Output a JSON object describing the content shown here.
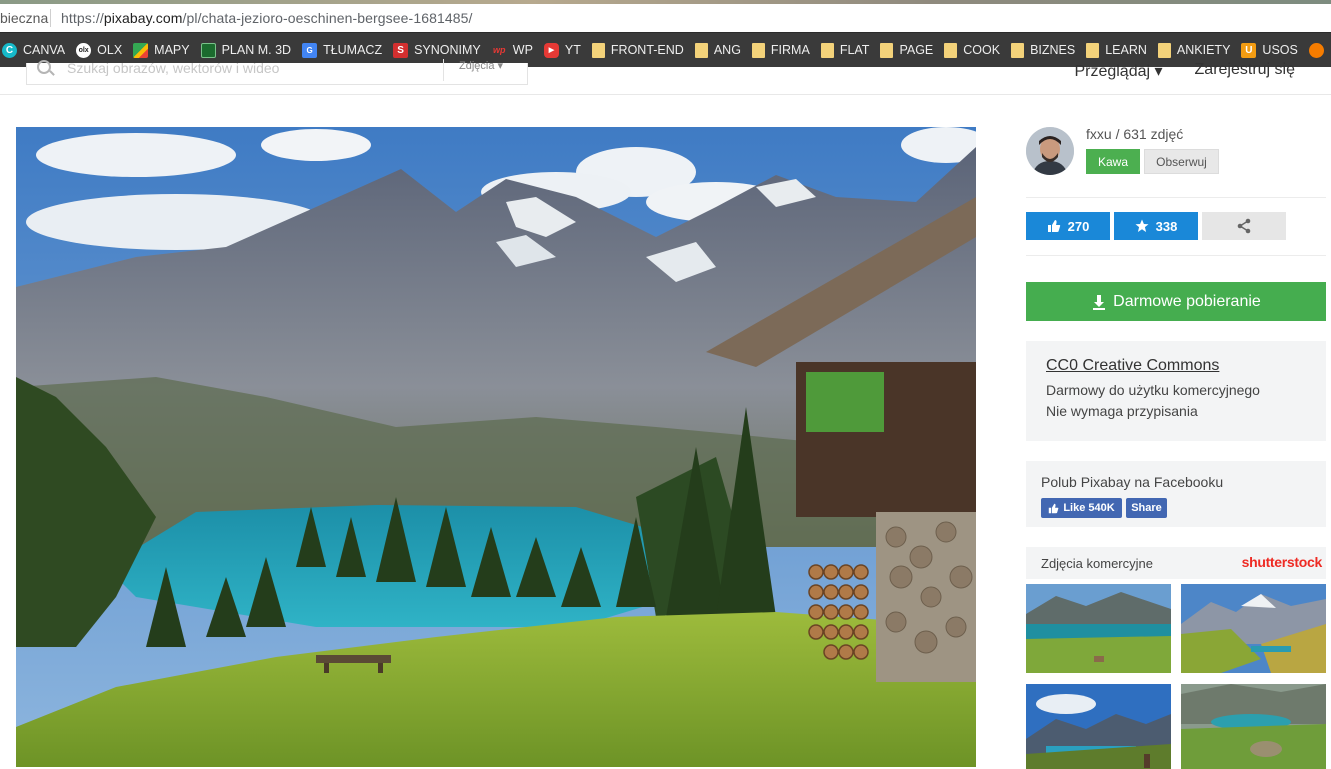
{
  "browser": {
    "security_label": "bieczna",
    "url_prefix": "https://",
    "url_host": "pixabay.com",
    "url_path": "/pl/chata-jezioro-oeschinen-bergsee-1681485/"
  },
  "bookmarks": [
    {
      "label": "CANVA",
      "icon": "canva-icon",
      "icon_text": "C"
    },
    {
      "label": "OLX",
      "icon": "olx-icon",
      "icon_text": "olx"
    },
    {
      "label": "MAPY",
      "icon": "maps-icon",
      "icon_text": ""
    },
    {
      "label": "PLAN M. 3D",
      "icon": "plan-icon",
      "icon_text": ""
    },
    {
      "label": "TŁUMACZ",
      "icon": "translate-icon",
      "icon_text": "G"
    },
    {
      "label": "SYNONIMY",
      "icon": "synonimy-icon",
      "icon_text": "S"
    },
    {
      "label": "WP",
      "icon": "wp-icon",
      "icon_text": "wp"
    },
    {
      "label": "YT",
      "icon": "youtube-icon",
      "icon_text": "▶"
    },
    {
      "label": "FRONT-END",
      "icon": "folder-icon",
      "icon_text": ""
    },
    {
      "label": "ANG",
      "icon": "folder-icon",
      "icon_text": ""
    },
    {
      "label": "FIRMA",
      "icon": "folder-icon",
      "icon_text": ""
    },
    {
      "label": "FLAT",
      "icon": "folder-icon",
      "icon_text": ""
    },
    {
      "label": "PAGE",
      "icon": "folder-icon",
      "icon_text": ""
    },
    {
      "label": "COOK",
      "icon": "folder-icon",
      "icon_text": ""
    },
    {
      "label": "BIZNES",
      "icon": "folder-icon",
      "icon_text": ""
    },
    {
      "label": "LEARN",
      "icon": "folder-icon",
      "icon_text": ""
    },
    {
      "label": "ANKIETY",
      "icon": "folder-icon",
      "icon_text": ""
    },
    {
      "label": "USOS",
      "icon": "usos-icon",
      "icon_text": "U"
    },
    {
      "label": "",
      "icon": "orange-icon",
      "icon_text": ""
    }
  ],
  "header": {
    "search_placeholder": "Szukaj obrazów, wektorów i wideo",
    "search_type": "Zdjęcia ▾",
    "nav_browse": "Przeglądaj ▾",
    "nav_register": "Zarejestruj się"
  },
  "author": {
    "name_line": "fxxu / 631 zdjęć",
    "coffee_label": "Kawa",
    "follow_label": "Obserwuj"
  },
  "stats": {
    "likes": "270",
    "favorites": "338"
  },
  "download": {
    "label": "Darmowe pobieranie"
  },
  "license": {
    "title": "CC0 Creative Commons",
    "line1": "Darmowy do użytku komercyjnego",
    "line2": "Nie wymaga przypisania"
  },
  "facebook": {
    "title": "Polub Pixabay na Facebooku",
    "like_label": "Like 540K",
    "share_label": "Share"
  },
  "commercial": {
    "title": "Zdjęcia komercyjne",
    "brand": "shutterstock"
  },
  "colors": {
    "bookmark_bar": "#3a3a3a",
    "like_blue": "#1a88d8",
    "download_green": "#45ad4f",
    "coffee_green": "#4caf50",
    "facebook_blue": "#4267b2",
    "shutterstock_red": "#ee2b24"
  }
}
